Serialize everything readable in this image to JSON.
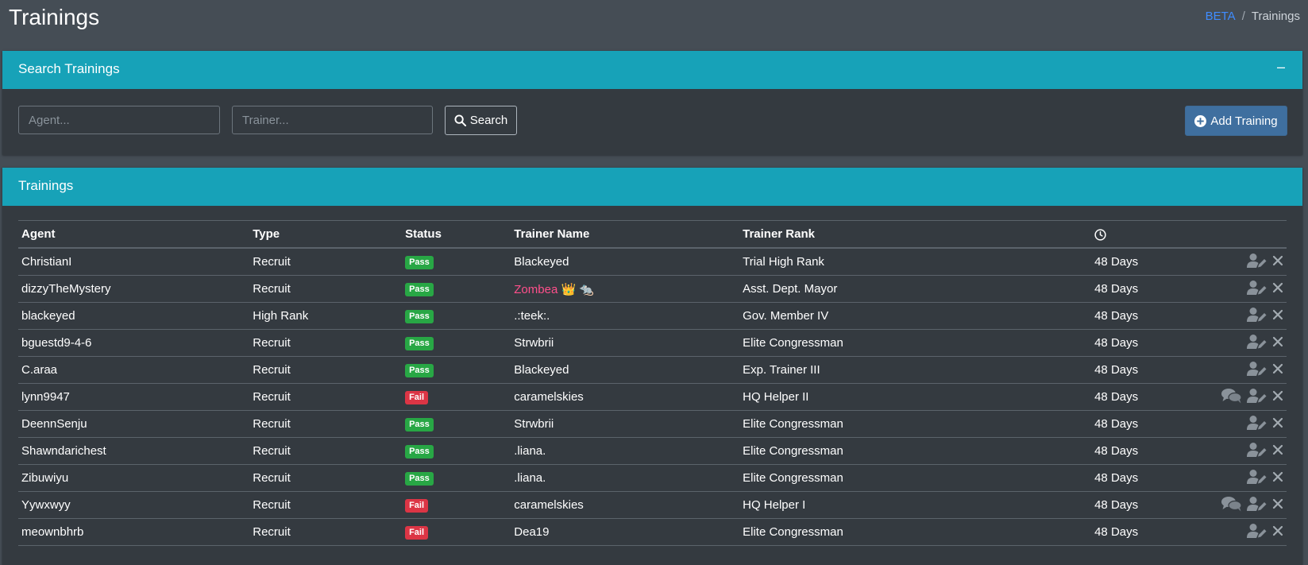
{
  "page": {
    "title": "Trainings"
  },
  "breadcrumb": {
    "link": "BETA",
    "separator": "/",
    "current": "Trainings"
  },
  "search_card": {
    "title": "Search Trainings",
    "collapse_label": "–",
    "agent_placeholder": "Agent...",
    "trainer_placeholder": "Trainer...",
    "search_label": "Search",
    "add_label": "Add Training"
  },
  "trainings_card": {
    "title": "Trainings",
    "columns": [
      "Agent",
      "Type",
      "Status",
      "Trainer Name",
      "Trainer Rank"
    ],
    "rows": [
      {
        "agent": "ChristianI",
        "type": "Recruit",
        "status": "Pass",
        "trainer": "Blackeyed",
        "rank": "Trial High Rank",
        "time": "48 Days",
        "comments": false
      },
      {
        "agent": "dizzyTheMystery",
        "type": "Recruit",
        "status": "Pass",
        "trainer": "Zombea 👑 🐀",
        "rank": "Asst. Dept. Mayor",
        "time": "48 Days",
        "comments": false
      },
      {
        "agent": "blackeyed",
        "type": "High Rank",
        "status": "Pass",
        "trainer": ".:teek:.",
        "rank": "Gov. Member IV",
        "time": "48 Days",
        "comments": false
      },
      {
        "agent": "bguestd9-4-6",
        "type": "Recruit",
        "status": "Pass",
        "trainer": "Strwbrii",
        "rank": "Elite Congressman",
        "time": "48 Days",
        "comments": false
      },
      {
        "agent": "C.araa",
        "type": "Recruit",
        "status": "Pass",
        "trainer": "Blackeyed",
        "rank": "Exp. Trainer III",
        "time": "48 Days",
        "comments": false
      },
      {
        "agent": "lynn9947",
        "type": "Recruit",
        "status": "Fail",
        "trainer": "caramelskies",
        "rank": "HQ Helper II",
        "time": "48 Days",
        "comments": true
      },
      {
        "agent": "DeennSenju",
        "type": "Recruit",
        "status": "Pass",
        "trainer": "Strwbrii",
        "rank": "Elite Congressman",
        "time": "48 Days",
        "comments": false
      },
      {
        "agent": "Shawndarichest",
        "type": "Recruit",
        "status": "Pass",
        "trainer": ".liana.",
        "rank": "Elite Congressman",
        "time": "48 Days",
        "comments": false
      },
      {
        "agent": "Zibuwiyu",
        "type": "Recruit",
        "status": "Pass",
        "trainer": ".liana.",
        "rank": "Elite Congressman",
        "time": "48 Days",
        "comments": false
      },
      {
        "agent": "Yywxwyy",
        "type": "Recruit",
        "status": "Fail",
        "trainer": "caramelskies",
        "rank": "HQ Helper I",
        "time": "48 Days",
        "comments": true
      },
      {
        "agent": "meownbhrb",
        "type": "Recruit",
        "status": "Fail",
        "trainer": "Dea19",
        "rank": "Elite Congressman",
        "time": "48 Days",
        "comments": false
      }
    ]
  },
  "colors": {
    "header_teal": "#17a2b8",
    "pass": "#28a745",
    "fail": "#dc3545",
    "add_button": "#3f6f9f"
  },
  "icons": [
    "search-icon",
    "plus-circle-icon",
    "clock-icon",
    "user-edit-icon",
    "close-icon",
    "comments-icon"
  ]
}
